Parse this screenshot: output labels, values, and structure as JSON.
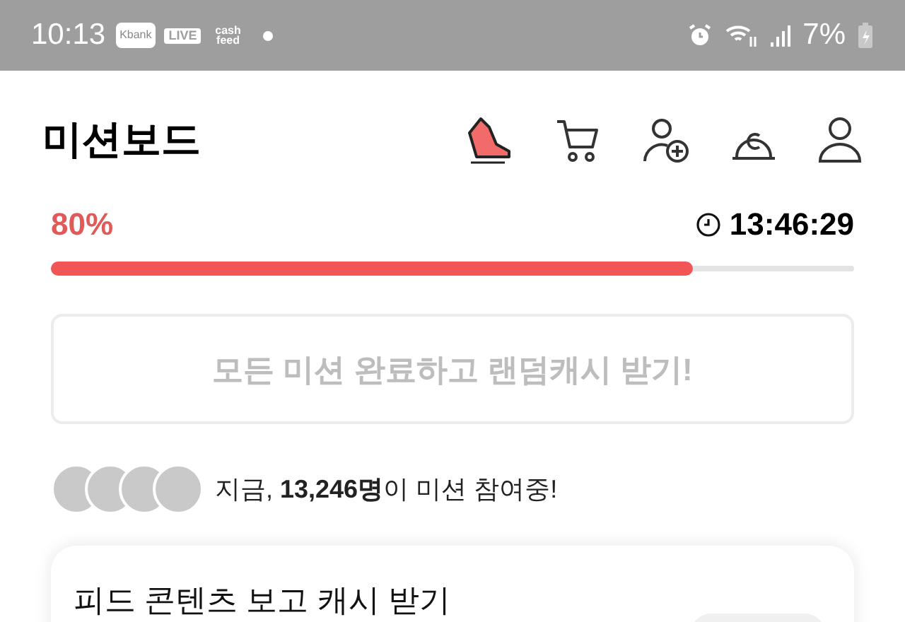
{
  "status_bar": {
    "time": "10:13",
    "apps": [
      {
        "kind": "tile",
        "label": "Kbank"
      },
      {
        "kind": "bubble",
        "label": "LIVE"
      },
      {
        "kind": "stack",
        "label": "cash feed"
      }
    ],
    "battery": "7%"
  },
  "header": {
    "title": "미션보드"
  },
  "progress": {
    "percent": "80%",
    "level": 0.8,
    "timer": "13:46:29"
  },
  "reward_button": {
    "label": "모든 미션 완료하고 랜덤캐시 받기!",
    "disabled": true
  },
  "participants": {
    "text": "지금, **13,246명**이 미션 참여중!"
  },
  "card": {
    "title": "피드 콘텐츠 보고 캐시 받기"
  }
}
